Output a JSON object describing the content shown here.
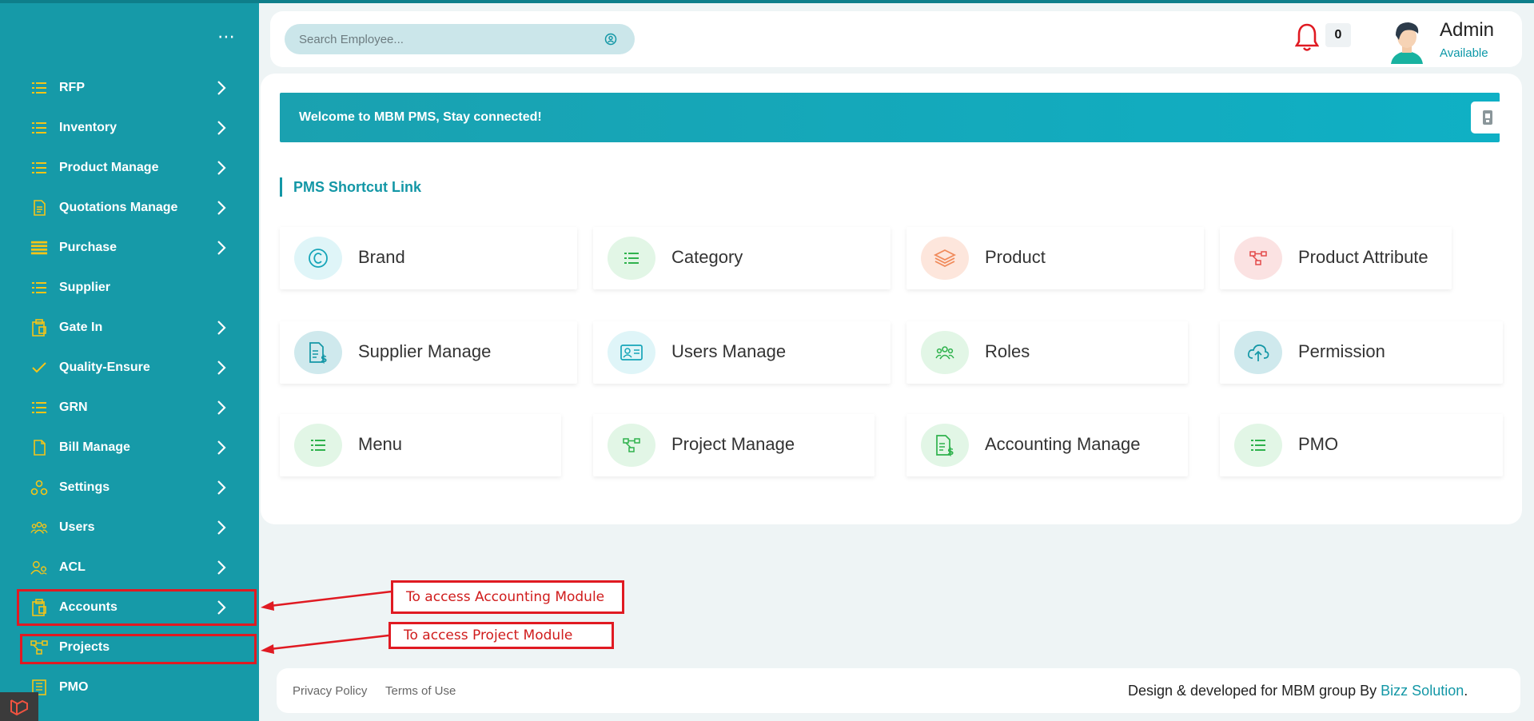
{
  "sidebar": {
    "menu_label": "⋯",
    "items": [
      {
        "label": "RFP",
        "icon": "list-icon",
        "chevron": true
      },
      {
        "label": "Inventory",
        "icon": "list-icon",
        "chevron": true
      },
      {
        "label": "Product Manage",
        "icon": "list-icon",
        "chevron": true
      },
      {
        "label": "Quotations Manage",
        "icon": "document-icon",
        "chevron": true
      },
      {
        "label": "Purchase",
        "icon": "bars-icon",
        "chevron": true
      },
      {
        "label": "Supplier",
        "icon": "list-icon",
        "chevron": false
      },
      {
        "label": "Gate In",
        "icon": "clipboard-icon",
        "chevron": true
      },
      {
        "label": "Quality-Ensure",
        "icon": "check-icon",
        "chevron": true
      },
      {
        "label": "GRN",
        "icon": "list-icon",
        "chevron": true
      },
      {
        "label": "Bill Manage",
        "icon": "file-icon",
        "chevron": true
      },
      {
        "label": "Settings",
        "icon": "settings-icon",
        "chevron": true
      },
      {
        "label": "Users",
        "icon": "users-icon",
        "chevron": true
      },
      {
        "label": "ACL",
        "icon": "acl-icon",
        "chevron": true
      },
      {
        "label": "Accounts",
        "icon": "clipboard-icon",
        "chevron": true
      },
      {
        "label": "Projects",
        "icon": "hierarchy-icon",
        "chevron": false
      },
      {
        "label": "PMO",
        "icon": "building-icon",
        "chevron": false
      }
    ]
  },
  "annotations": {
    "accounting_note": "To access Accounting Module",
    "project_note": "To access Project Module",
    "color": "#e01a22"
  },
  "topbar": {
    "search_placeholder": "Search Employee...",
    "notification_count": "0",
    "user_name": "Admin",
    "user_status": "Available"
  },
  "welcome": {
    "text": "Welcome to MBM PMS, Stay connected!"
  },
  "shortcuts": {
    "title": "PMS Shortcut Link",
    "cards": [
      {
        "label": "Brand",
        "icon": "copyright-icon",
        "color": "#16a5b8"
      },
      {
        "label": "Category",
        "icon": "list-icon",
        "color": "#2fb24d"
      },
      {
        "label": "Product",
        "icon": "layers-icon",
        "color": "#f08a5a"
      },
      {
        "label": "Product Attribute",
        "icon": "hierarchy-icon",
        "color": "#e34a4a"
      },
      {
        "label": "Supplier Manage",
        "icon": "invoice-icon",
        "color": "#1397a6"
      },
      {
        "label": "Users Manage",
        "icon": "id-card-icon",
        "color": "#16a5b8"
      },
      {
        "label": "Roles",
        "icon": "users-icon",
        "color": "#2fb24d"
      },
      {
        "label": "Permission",
        "icon": "cloud-upload-icon",
        "color": "#1397a6"
      },
      {
        "label": "Menu",
        "icon": "list-icon",
        "color": "#2fb24d"
      },
      {
        "label": "Project Manage",
        "icon": "hierarchy-icon",
        "color": "#2fb24d"
      },
      {
        "label": "Accounting Manage",
        "icon": "invoice-icon",
        "color": "#2fb24d"
      },
      {
        "label": "PMO",
        "icon": "list-icon",
        "color": "#2fb24d"
      }
    ]
  },
  "footer": {
    "privacy": "Privacy Policy",
    "terms": "Terms of Use",
    "credit_prefix": "Design & developed for MBM group By ",
    "credit_brand": "Bizz Solution",
    "credit_suffix": "."
  },
  "colors": {
    "primary": "#1397a6",
    "icon_yellow": "#f5c518",
    "alert_red": "#e01a22"
  }
}
